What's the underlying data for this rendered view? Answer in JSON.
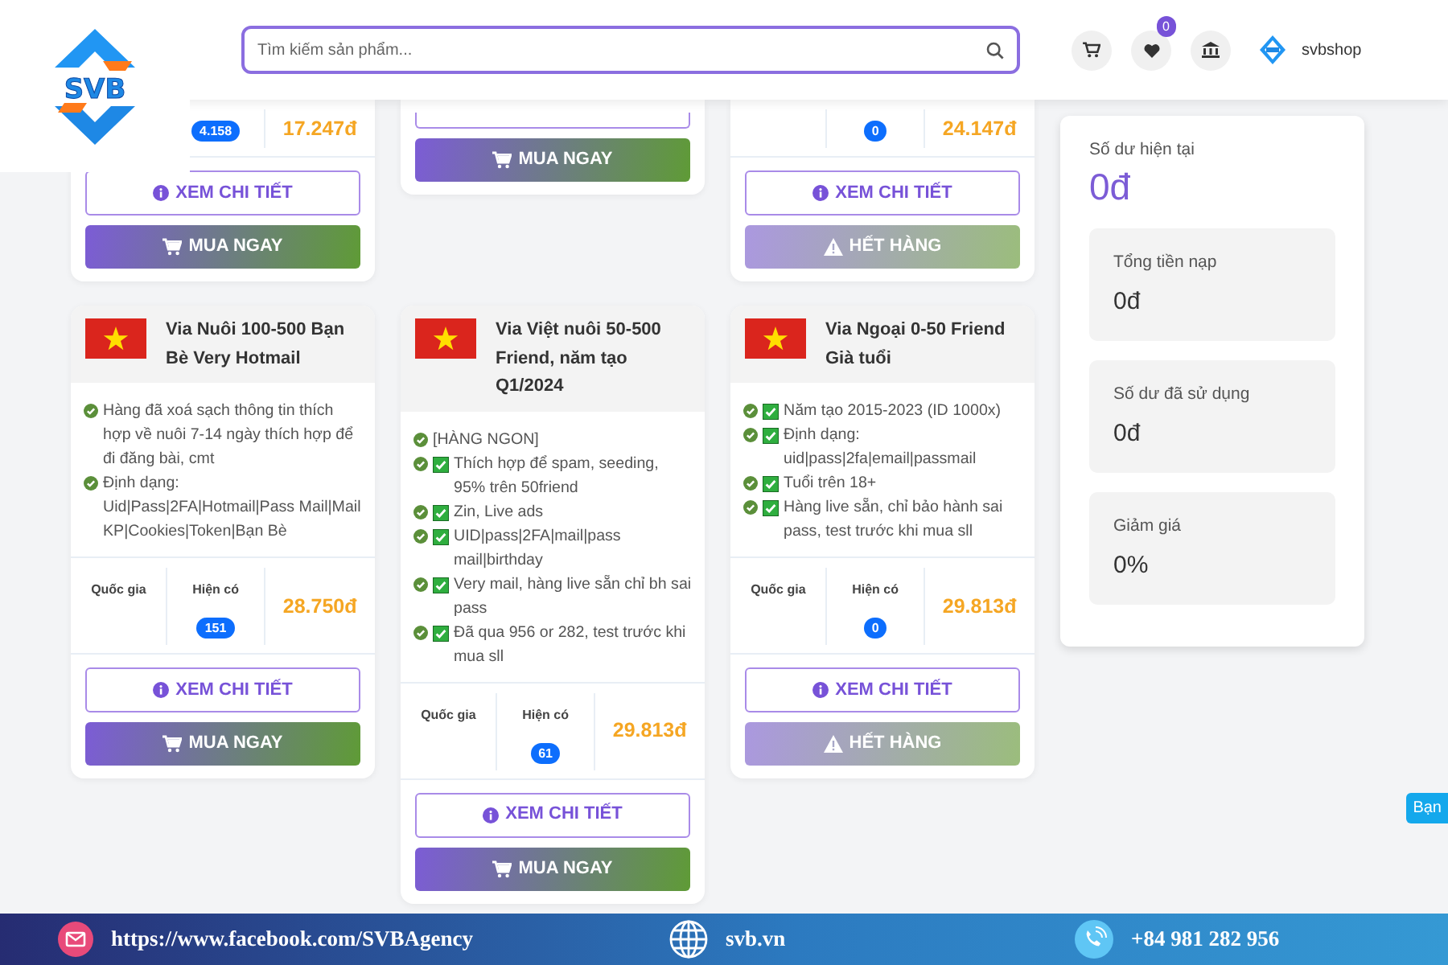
{
  "header": {
    "logo_text": "SVB",
    "search": {
      "placeholder": "Tìm kiếm sản phẩm..."
    },
    "wishlist_count": "0",
    "username": "svbshop"
  },
  "top_products": [
    {
      "stock": "4.158",
      "price": "17.247đ",
      "details_label": "XEM CHI TIẾT",
      "buy_label": "MUA NGAY",
      "sold_out": false
    },
    {
      "buy_label": "MUA NGAY",
      "sold_out": false
    },
    {
      "stock": "0",
      "price": "24.147đ",
      "details_label": "XEM CHI TIẾT",
      "buy_label": "HẾT HÀNG",
      "sold_out": true
    }
  ],
  "products": [
    {
      "title": "Via Nuôi 100-500 Bạn Bè Very Hotmail",
      "features": [
        {
          "text": "Hàng đã xoá sạch thông tin thích hợp về nuôi 7-14 ngày thích hợp để đi đăng bài, cmt",
          "boxed": false
        },
        {
          "text": "Định dạng: Uid|Pass|2FA|Hotmail|Pass Mail|Mail KP|Cookies|Token|Bạn Bè",
          "boxed": false
        }
      ],
      "country_label": "Quốc gia",
      "stock_label": "Hiện có",
      "stock": "151",
      "price": "28.750đ",
      "details_label": "XEM CHI TIẾT",
      "buy_label": "MUA NGAY",
      "sold_out": false
    },
    {
      "title": "Via Việt nuôi 50-500 Friend, năm tạo Q1/2024",
      "features": [
        {
          "text": "[HÀNG NGON]",
          "boxed": false
        },
        {
          "text": "Thích hợp để spam, seeding, 95% trên 50friend",
          "boxed": true
        },
        {
          "text": "Zin, Live ads",
          "boxed": true
        },
        {
          "text": "UID|pass|2FA|mail|pass mail|birthday",
          "boxed": true
        },
        {
          "text": "Very mail, hàng live sẵn chỉ bh sai pass",
          "boxed": true
        },
        {
          "text": "Đã qua 956 or 282, test trước khi mua sll",
          "boxed": true
        }
      ],
      "country_label": "Quốc gia",
      "stock_label": "Hiện có",
      "stock": "61",
      "price": "29.813đ",
      "details_label": "XEM CHI TIẾT",
      "buy_label": "MUA NGAY",
      "sold_out": false
    },
    {
      "title": "Via Ngoại 0-50 Friend Già tuổi",
      "features": [
        {
          "text": "Năm tạo 2015-2023 (ID 1000x)",
          "boxed": true
        },
        {
          "text": "Định dạng: uid|pass|2fa|email|passmail",
          "boxed": true
        },
        {
          "text": "Tuổi trên 18+",
          "boxed": true
        },
        {
          "text": "Hàng live sẵn, chỉ bảo hành sai pass, test trước khi mua sll",
          "boxed": true
        }
      ],
      "country_label": "Quốc gia",
      "stock_label": "Hiện có",
      "stock": "0",
      "price": "29.813đ",
      "details_label": "XEM CHI TIẾT",
      "buy_label": "HẾT HÀNG",
      "sold_out": true
    }
  ],
  "balance": {
    "label": "Số dư hiện tại",
    "value": "0đ",
    "stats": [
      {
        "label": "Tổng tiền nạp",
        "value": "0đ"
      },
      {
        "label": "Số dư đã sử dụng",
        "value": "0đ"
      },
      {
        "label": "Giảm giá",
        "value": "0%"
      }
    ]
  },
  "footer": [
    {
      "kind": "mail",
      "text": "https://www.facebook.com/SVBAgency"
    },
    {
      "kind": "web",
      "text": "svb.vn"
    },
    {
      "kind": "phone",
      "text": "+84 981 282 956"
    }
  ],
  "chat_tab": {
    "label": "Bạn"
  }
}
